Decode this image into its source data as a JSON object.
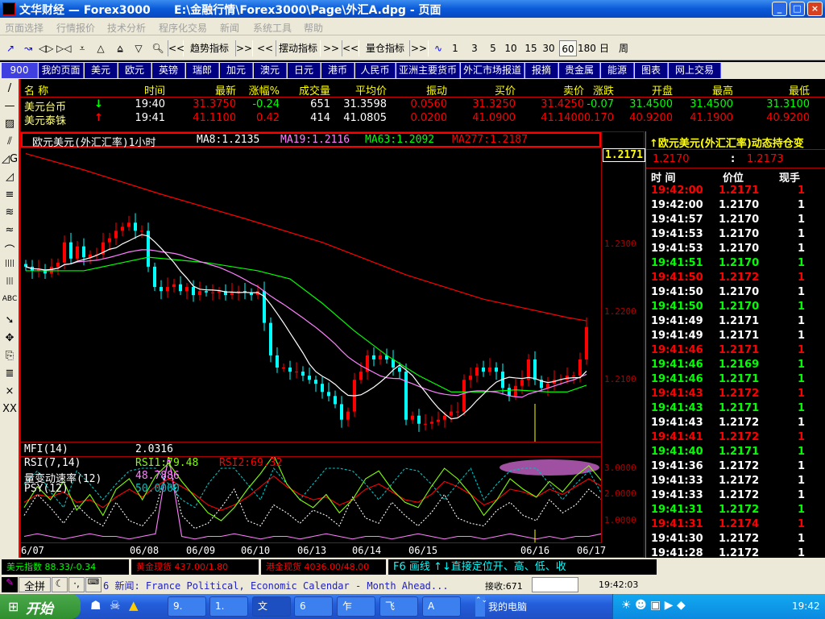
{
  "window": {
    "title": "文华财经 — Forex3000      E:\\金融行情\\Forex3000\\Page\\外汇A.dpg - 页面",
    "min": "_",
    "max": "□",
    "close": "×"
  },
  "menu": [
    "页面选择",
    "行情报价",
    "技术分析",
    "程序化交易",
    "新闻",
    "系统工具",
    "帮助"
  ],
  "toolbar": {
    "prev": "<<",
    "next": ">>",
    "trend": "趋势指标",
    "swing": "摆动指标",
    "volume": "量仓指标",
    "periods": [
      "1",
      "3",
      "5",
      "10",
      "15",
      "30",
      "60",
      "180",
      "日",
      "周"
    ],
    "selected_period": "60"
  },
  "tabs": [
    "900",
    "我的页面",
    "美元",
    "欧元",
    "英镑",
    "瑞郎",
    "加元",
    "澳元",
    "日元",
    "港币",
    "人民币",
    "亚洲主要货币",
    "外汇市场报道",
    "报摘",
    "贵金属",
    "能源",
    "图表",
    "网上交易"
  ],
  "left_tools": [
    "/",
    "—",
    "▨",
    "⫽",
    "◿G",
    "◿",
    "≡",
    "≋",
    "≈",
    "⌒",
    "||||",
    "|||",
    "ABC",
    "➘",
    "✥",
    "⎘",
    "≣",
    "×",
    "XX"
  ],
  "quote": {
    "headers": [
      "名 称",
      "时间",
      "最新",
      "涨幅%",
      "成交量",
      "平均价",
      "振动",
      "买价",
      "卖价",
      "涨跌",
      "开盘",
      "最高",
      "最低"
    ],
    "rows": [
      {
        "name": "美元台币",
        "dir": "down",
        "cells": [
          "19:40",
          "31.3750",
          "-0.24",
          "651",
          "31.3598",
          "0.0560",
          "31.3250",
          "31.4250",
          "-0.07",
          "31.4500",
          "31.4500",
          "31.3100"
        ],
        "colors": [
          "#fff",
          "#f00",
          "#0f0",
          "#fff",
          "#fff",
          "#f00",
          "#f00",
          "#f00",
          "#0f0",
          "#0f0",
          "#0f0",
          "#0f0"
        ]
      },
      {
        "name": "美元泰铢",
        "dir": "up",
        "cells": [
          "19:41",
          "41.1100",
          "0.42",
          "414",
          "41.0805",
          "0.0200",
          "41.0900",
          "41.1400",
          "0.170",
          "40.9200",
          "41.1900",
          "40.9200"
        ],
        "colors": [
          "#fff",
          "#f00",
          "#f00",
          "#fff",
          "#fff",
          "#f00",
          "#f00",
          "#f00",
          "#f00",
          "#f00",
          "#f00",
          "#f00"
        ]
      }
    ]
  },
  "chart_header": {
    "title": "欧元美元(外汇汇率)1小时",
    "ma8": "MA8:1.2135",
    "ma19": "MA19:1.2116",
    "ma63": "MA63:1.2092",
    "ma277": "MA277:1.2187",
    "last_price": "1.2171"
  },
  "chart_data": {
    "type": "candlestick",
    "title": "欧元美元(外汇汇率)1小时",
    "y_ticks": [
      "1.2300",
      "1.2200",
      "1.2100"
    ],
    "ylim": [
      1.2011,
      1.2444
    ],
    "x_ticks": [
      "6/07",
      "06/08",
      "06/09",
      "06/10",
      "06/13",
      "06/14",
      "06/15",
      "06/16",
      "06/17"
    ],
    "close": [
      1.2268,
      1.2262,
      1.2264,
      1.2258,
      1.2268,
      1.2274,
      1.2304,
      1.228,
      1.2298,
      1.2282,
      1.2286,
      1.2286,
      1.2304,
      1.231,
      1.2321,
      1.2327,
      1.2333,
      1.2321,
      1.2321,
      1.2268,
      1.2238,
      1.2232,
      1.2238,
      1.2242,
      1.2232,
      1.2238,
      1.2226,
      1.2232,
      1.223,
      1.223,
      1.2232,
      1.2226,
      1.223,
      1.2232,
      1.223,
      1.2226,
      1.2232,
      1.2185,
      1.2137,
      1.2119,
      1.2119,
      1.2113,
      1.2113,
      1.2107,
      1.2101,
      1.2095,
      1.2083,
      1.2077,
      1.2065,
      1.2042,
      1.2054,
      1.2101,
      1.2113,
      1.2137,
      1.2131,
      1.2137,
      1.2131,
      1.2119,
      1.2113,
      1.2042,
      1.2048,
      1.2036,
      1.2036,
      1.2039,
      1.2042,
      1.2048,
      1.2054,
      1.2054,
      1.2101,
      1.2107,
      1.2119,
      1.2113,
      1.2119,
      1.2113,
      1.2089,
      1.2077,
      1.2092,
      1.2101,
      1.2131,
      1.2101,
      1.2089,
      1.2095,
      1.2101,
      1.2101,
      1.2107,
      1.2107,
      1.2131,
      1.2179
    ],
    "ma63": [
      [
        0,
        1.2262
      ],
      [
        9,
        1.2262
      ],
      [
        15,
        1.2274
      ],
      [
        19,
        1.2282
      ],
      [
        28,
        1.2274
      ],
      [
        36,
        1.2262
      ],
      [
        41,
        1.225
      ],
      [
        46,
        1.2214
      ],
      [
        51,
        1.2173
      ],
      [
        56,
        1.2137
      ],
      [
        61,
        1.2107
      ],
      [
        66,
        1.2083
      ],
      [
        71,
        1.2083
      ],
      [
        76,
        1.2086
      ],
      [
        81,
        1.2083
      ],
      [
        84,
        1.2083
      ],
      [
        87,
        1.2093
      ]
    ],
    "ma277": [
      [
        0,
        1.2435
      ],
      [
        9,
        1.2411
      ],
      [
        21,
        1.2375
      ],
      [
        34,
        1.2339
      ],
      [
        46,
        1.2304
      ],
      [
        59,
        1.2256
      ],
      [
        71,
        1.222
      ],
      [
        84,
        1.2193
      ],
      [
        87,
        1.2188
      ]
    ],
    "colors": {
      "up": "#ff0000",
      "down": "#00ffff",
      "ma8": "#ffffff",
      "ma19": "#ff80ff",
      "ma63": "#00ff00",
      "ma277": "#ff0000"
    }
  },
  "indicators": {
    "mfi_label": "MFI(14)",
    "mfi_value": "2.0316",
    "rsi_label": "RSI(7,14)",
    "rsi1": "RSI1:79.48",
    "rsi2": "RSI2:69.32",
    "roc_label": "量变动速率(12)",
    "roc_value": "48.7886",
    "psy_label": "PSY(12)",
    "psy_value": "50.0000",
    "y_ticks": [
      "3.0000",
      "2.0000",
      "1.0000"
    ],
    "series": {
      "rsi1": [
        1.5,
        2.3,
        1.8,
        2.5,
        1.4,
        2.0,
        1.2,
        2.2,
        2.6,
        1.8,
        2.7,
        3.2,
        2.5,
        1.9,
        1.3,
        1.0,
        1.5,
        2.2,
        2.8,
        3.5,
        2.4,
        1.8,
        1.5,
        2.0,
        1.3,
        1.8,
        2.6,
        2.9,
        2.2,
        1.7,
        1.5,
        2.3,
        3.0,
        2.6,
        2.0,
        1.2,
        1.8,
        2.6,
        2.2,
        1.9,
        2.5,
        2.1,
        2.7,
        3.1,
        2.5
      ],
      "rsi2": [
        1.7,
        2.0,
        1.9,
        2.1,
        1.7,
        1.8,
        1.5,
        1.9,
        2.2,
        1.9,
        2.3,
        2.6,
        2.3,
        2.0,
        1.6,
        1.4,
        1.6,
        1.9,
        2.3,
        2.7,
        2.3,
        2.0,
        1.8,
        1.9,
        1.6,
        1.8,
        2.2,
        2.4,
        2.1,
        1.8,
        1.7,
        2.0,
        2.5,
        2.3,
        2.0,
        1.6,
        1.8,
        2.2,
        2.1,
        1.9,
        2.2,
        2.0,
        2.3,
        2.6,
        2.3
      ],
      "psy": [
        2.4,
        2.9,
        2.1,
        1.5,
        2.9,
        2.4,
        1.8,
        2.4,
        2.9,
        3.0,
        3.0,
        2.4,
        1.8,
        1.5,
        2.4,
        3.0,
        3.0,
        2.4,
        1.8,
        3.0,
        2.4,
        1.8,
        2.4,
        3.0,
        3.0,
        2.9,
        2.4,
        1.8,
        2.4,
        3.0,
        2.9,
        2.4,
        1.8,
        2.4,
        3.0,
        1.8,
        2.4,
        2.9,
        3.0,
        3.0,
        2.4,
        1.8,
        2.4,
        2.9,
        2.0
      ],
      "mfi": [
        1.2,
        2.0,
        1.5,
        0.9,
        1.6,
        1.1,
        0.8,
        1.7,
        1.0,
        0.8,
        1.4,
        3.3,
        1.2,
        0.7,
        0.9,
        1.5,
        2.2,
        1.0,
        0.8,
        1.6,
        1.3,
        0.9,
        1.4,
        1.2,
        0.8,
        1.9,
        1.1,
        0.9,
        1.7,
        1.2,
        0.8,
        1.3,
        2.0,
        1.1,
        0.9,
        0.8,
        1.4,
        1.7,
        1.2,
        1.0,
        1.8,
        1.3,
        1.6,
        2.2,
        1.8
      ],
      "roc": [
        0.4,
        0.5,
        0.4,
        0.3,
        0.4,
        0.5,
        0.4,
        0.4,
        0.3,
        0.4,
        0.5,
        3.5,
        0.4,
        0.3,
        0.4,
        0.4,
        0.5,
        0.4,
        0.3,
        0.4,
        0.4,
        0.3,
        0.4,
        0.5,
        0.4,
        0.3,
        0.4,
        0.4,
        0.3,
        0.4,
        0.5,
        0.4,
        0.3,
        0.4,
        0.4,
        0.3,
        0.4,
        0.5,
        0.4,
        0.3,
        0.4,
        0.3,
        0.4,
        0.4,
        0.5
      ]
    }
  },
  "ticks": {
    "title": "↑欧元美元(外汇汇率)动态持仓变",
    "bid": "1.2170",
    "sep": ":",
    "ask": "1.2173",
    "headers": [
      "时 间",
      "价位",
      "现手"
    ],
    "rows": [
      [
        "19:42:00",
        "1.2171",
        "1",
        "r"
      ],
      [
        "19:42:00",
        "1.2170",
        "1",
        "w"
      ],
      [
        "19:41:57",
        "1.2170",
        "1",
        "w"
      ],
      [
        "19:41:53",
        "1.2170",
        "1",
        "w"
      ],
      [
        "19:41:53",
        "1.2170",
        "1",
        "w"
      ],
      [
        "19:41:51",
        "1.2170",
        "1",
        "g"
      ],
      [
        "19:41:50",
        "1.2172",
        "1",
        "r"
      ],
      [
        "19:41:50",
        "1.2170",
        "1",
        "w"
      ],
      [
        "19:41:50",
        "1.2170",
        "1",
        "g"
      ],
      [
        "19:41:49",
        "1.2171",
        "1",
        "w"
      ],
      [
        "19:41:49",
        "1.2171",
        "1",
        "w"
      ],
      [
        "19:41:46",
        "1.2171",
        "1",
        "r"
      ],
      [
        "19:41:46",
        "1.2169",
        "1",
        "g"
      ],
      [
        "19:41:46",
        "1.2171",
        "1",
        "g"
      ],
      [
        "19:41:43",
        "1.2172",
        "1",
        "r"
      ],
      [
        "19:41:43",
        "1.2171",
        "1",
        "g"
      ],
      [
        "19:41:43",
        "1.2172",
        "1",
        "w"
      ],
      [
        "19:41:41",
        "1.2172",
        "1",
        "r"
      ],
      [
        "19:41:40",
        "1.2171",
        "1",
        "g"
      ],
      [
        "19:41:36",
        "1.2172",
        "1",
        "w"
      ],
      [
        "19:41:33",
        "1.2172",
        "1",
        "w"
      ],
      [
        "19:41:33",
        "1.2172",
        "1",
        "w"
      ],
      [
        "19:41:31",
        "1.2172",
        "1",
        "g"
      ],
      [
        "19:41:31",
        "1.2174",
        "1",
        "r"
      ],
      [
        "19:41:30",
        "1.2172",
        "1",
        "w"
      ],
      [
        "19:41:28",
        "1.2172",
        "1",
        "w"
      ]
    ]
  },
  "status": {
    "usd_index": "美元指数 88.33/-0.34",
    "gold_spot": "黄金现货 437.00/1.80",
    "hk_gold": "港金现货 4036.00/48.00",
    "hint": "F6 画线  ↑↓直接定位开、高、低、收"
  },
  "news": {
    "ime": "全拼",
    "ime_moon": "☾",
    "ime_punct": "·,",
    "ticker": "6 新闻: France Political, Economic Calendar - Month Ahead...",
    "received": "接收:671",
    "time": "19:42:03"
  },
  "taskbar": {
    "start": "开始",
    "tasks": [
      "9.",
      "1.",
      "文",
      "6",
      "乍",
      "飞",
      "A"
    ],
    "mycomputer": "我的电脑",
    "clock": "19:42"
  }
}
